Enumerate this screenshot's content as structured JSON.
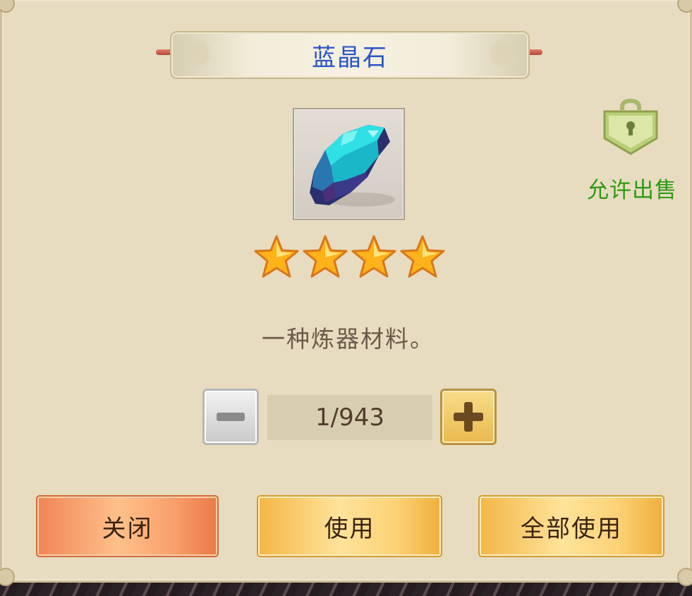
{
  "dialog": {
    "title": "蓝晶石",
    "item_icon": "blue-crystal-icon",
    "rarity_stars": 4,
    "description": "一种炼器材料。",
    "sell_status_label": "允许出售",
    "sell_lock_icon": "lock-icon",
    "quantity": {
      "display": "1/943",
      "selected": 1,
      "max": 943
    },
    "buttons": {
      "close": "关闭",
      "use": "使用",
      "use_all": "全部使用"
    },
    "colors": {
      "title": "#2a55c6",
      "sell_status": "#2d9a12",
      "close_button": "#ef8554",
      "use_button": "#f3b646"
    }
  }
}
